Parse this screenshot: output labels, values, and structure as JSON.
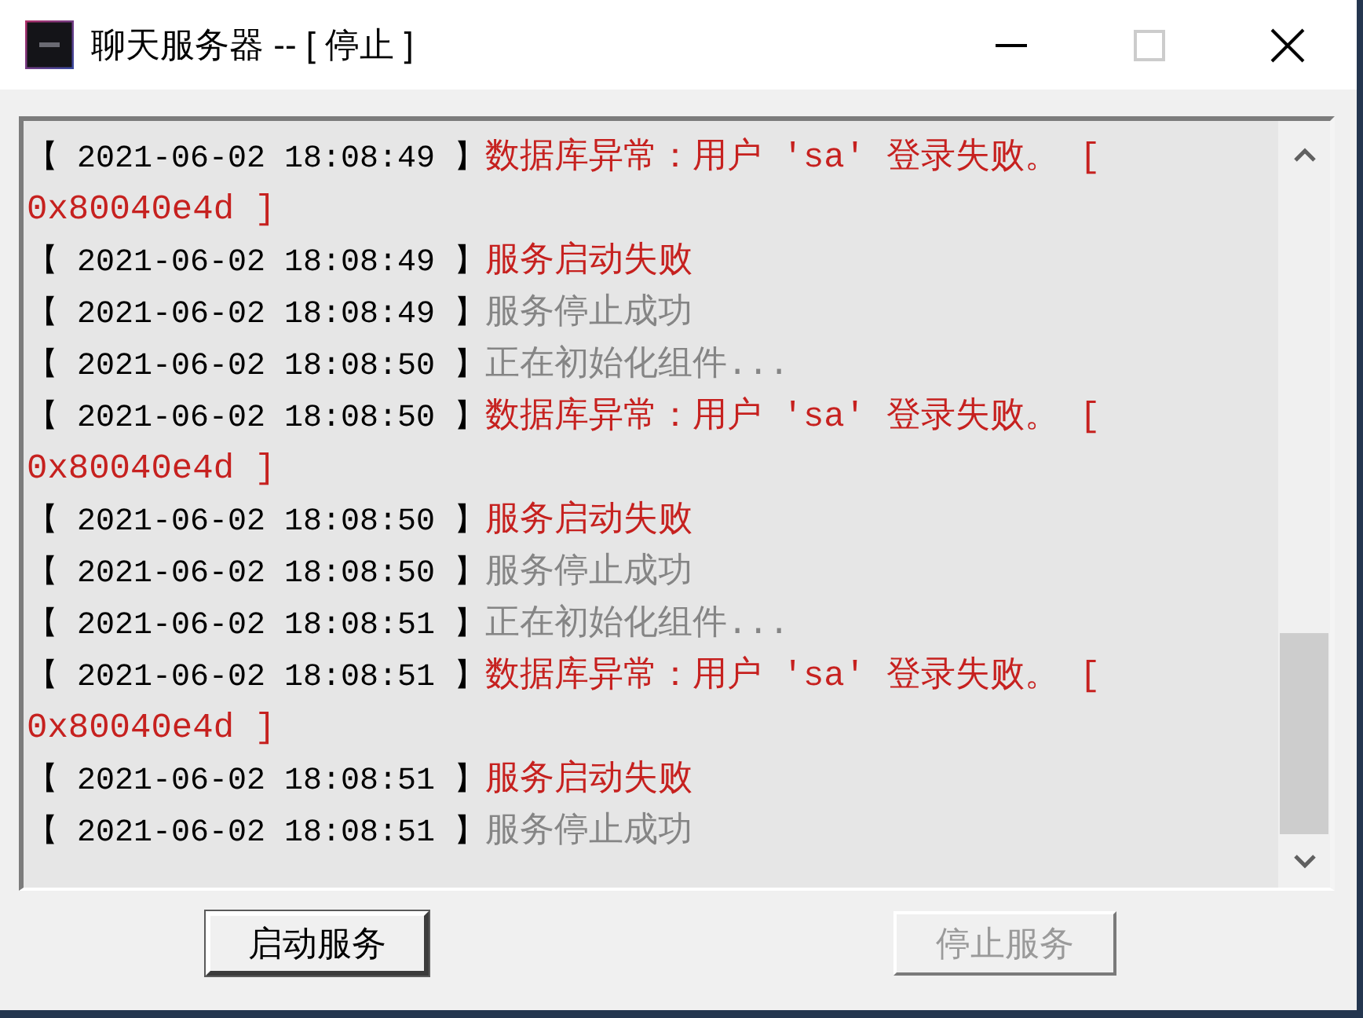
{
  "window": {
    "title": "聊天服务器 -- [ 停止 ]",
    "title_buttons": [
      {
        "kind": "minimize",
        "disabled": false
      },
      {
        "kind": "maximize",
        "disabled": true
      },
      {
        "kind": "close",
        "disabled": false
      }
    ]
  },
  "log": [
    {
      "timestamp": "【 2021-06-02 18:08:49 】",
      "message": "数据库异常：用户 'sa' 登录失败。 [ 0x80040e4d ]",
      "kind": "error"
    },
    {
      "timestamp": "【 2021-06-02 18:08:49 】",
      "message": "服务启动失败",
      "kind": "error"
    },
    {
      "timestamp": "【 2021-06-02 18:08:49 】",
      "message": "服务停止成功",
      "kind": "info"
    },
    {
      "timestamp": "【 2021-06-02 18:08:50 】",
      "message": "正在初始化组件...",
      "kind": "info"
    },
    {
      "timestamp": "【 2021-06-02 18:08:50 】",
      "message": "数据库异常：用户 'sa' 登录失败。 [ 0x80040e4d ]",
      "kind": "error"
    },
    {
      "timestamp": "【 2021-06-02 18:08:50 】",
      "message": "服务启动失败",
      "kind": "error"
    },
    {
      "timestamp": "【 2021-06-02 18:08:50 】",
      "message": "服务停止成功",
      "kind": "info"
    },
    {
      "timestamp": "【 2021-06-02 18:08:51 】",
      "message": "正在初始化组件...",
      "kind": "info"
    },
    {
      "timestamp": "【 2021-06-02 18:08:51 】",
      "message": "数据库异常：用户 'sa' 登录失败。 [ 0x80040e4d ]",
      "kind": "error"
    },
    {
      "timestamp": "【 2021-06-02 18:08:51 】",
      "message": "服务启动失败",
      "kind": "error"
    },
    {
      "timestamp": "【 2021-06-02 18:08:51 】",
      "message": "服务停止成功",
      "kind": "info"
    }
  ],
  "buttons": [
    {
      "label": "启动服务",
      "disabled": false
    },
    {
      "label": "停止服务",
      "disabled": true
    }
  ]
}
